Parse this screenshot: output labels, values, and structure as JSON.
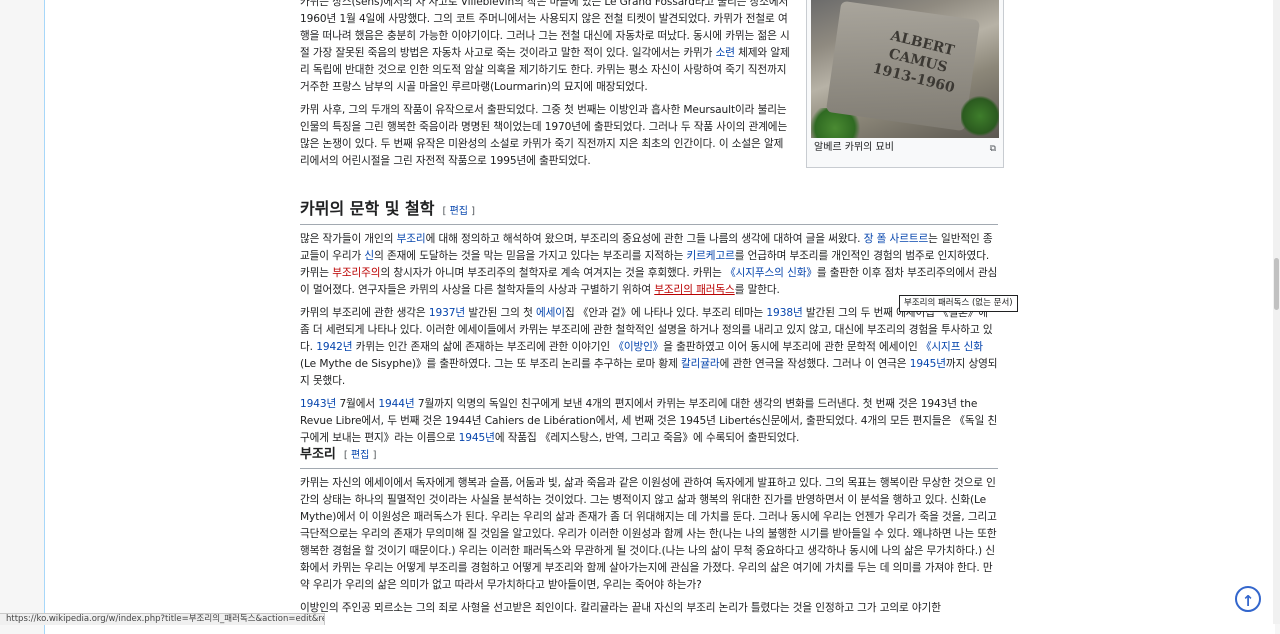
{
  "paragraphs": {
    "p1": "카뮈는 상스(sens)에서의 차 사고로 Villeblevin의 작은 마을에 있는 Le Grand Fossard라고 불리는 장소에서 1960년 1월 4일에 사망했다. 그의 코트 주머니에서는 사용되지 않은 전철 티켓이 발견되었다. 카뮈가 전철로 여행을 떠나려 했음은 충분히 가능한 이야기이다. 그러나 그는 전철 대신에 자동차로 떠났다. 동시에 카뮈는 젊은 시절 가장 잘못된 죽음의 방법은 자동차 사고로 죽는 것이라고 말한 적이 있다. 일각에서는 카뮈가 ",
    "p1_link": "소련",
    "p1_end": " 체제와 알제리 독립에 반대한 것으로 인한 의도적 암살 의혹을 제기하기도 한다. 카뮈는 평소 자신이 사랑하여 죽기 직전까지 거주한 프랑스 남부의 시골 마을인 루르마랭(Lourmarin)의 묘지에 매장되었다.",
    "p2": "카뮈 사후, 그의 두개의 작품이 유작으로서 출판되었다. 그중 첫 번째는 이방인과 흡사한 Meursault이라 불리는 인물의 특징을 그린 행복한 죽음이라 명명된 책이었는데 1970년에 출판되었다. 그러나 두 작품 사이의 관계에는 많은 논쟁이 있다. 두 번째 유작은 미완성의 소설로 카뮈가 죽기 직전까지 지은 최초의 인간이다. 이 소설은 알제리에서의 어린시절을 그린 자전적 작품으로 1995년에 출판되었다."
  },
  "thumb": {
    "engraving_line1": "ALBERT CAMUS",
    "engraving_line2": "1913-1960",
    "caption": "알베르 카뮈의 묘비",
    "magnify_icon": "⧉"
  },
  "section1": {
    "title": "카뮈의 문학 및 철학",
    "edit_open": "[ ",
    "edit_label": "편집",
    "edit_close": " ]",
    "p1": {
      "a": "많은 작가들이 개인의 ",
      "l1": "부조리",
      "b": "에 대해 정의하고 해석하여 왔으며, 부조리의 중요성에 관한 그들 나름의 생각에 대하여 글을 써왔다. ",
      "l2": "장 폴 사르트르",
      "c": "는 일반적인 종교들이 우리가 ",
      "l3": "신",
      "d": "의 존재에 도달하는 것을 막는 믿음을 가지고 있다는 부조리를 지적하는 ",
      "l4": "키르케고르",
      "e": "를 언급하며 부조리를 개인적인 경험의 범주로 인지하였다. 카뮈는 ",
      "l5": "부조리주의",
      "f": "의 창시자가 아니며 부조리주의 철학자로 계속 여겨지는 것을 후회했다. 카뮈는 ",
      "l6": "《시지푸스의 신화》",
      "g": "를 출판한 이후 점차 부조리주의에서 관심이 멀어졌다. 연구자들은 카뮈의 사상을 다른 철학자들의 사상과 구별하기 위하여 ",
      "l7": "부조리의 패러독스",
      "h": "를 말한다."
    },
    "p2": {
      "a": "카뮈의 부조리에 관한 생각은 ",
      "l1": "1937년",
      "b": " 발간된 그의 첫 ",
      "l2": "에세이",
      "c": "집 《안과 겉》에 나타나 있다. 부조리 테마는 ",
      "l3": "1938년",
      "d": " 발간된 그의 두 번째 에세이집 《결혼》에 좀 더 세련되게 나타나 있다. 이러한 에세이들에서 카뮈는 부조리에 관한 철학적인 설명을 하거나 정의를 내리고 있지 않고, 대신에 부조리의 경험을 투사하고 있다. ",
      "l4": "1942년",
      "e": " 카뮈는 인간 존재의 삶에 존재하는 부조리에 관한 이야기인 ",
      "l5": "《이방인》",
      "f": "을 출판하였고 이어 동시에 부조리에 관한 문학적 에세이인 ",
      "l6": "《시지프 신화",
      "g": "(Le Mythe de Sisyphe)》를 출판하였다. 그는 또 부조리 논리를 추구하는 로마 황제 ",
      "l7": "칼리귤라",
      "h": "에 관한 연극을 작성했다. 그러나 이 연극은 ",
      "l8": "1945년",
      "i": "까지 상영되지 못했다."
    },
    "p3": {
      "l1": "1943년",
      "a": " 7월에서 ",
      "l2": "1944년",
      "b": " 7월까지 익명의 독일인 친구에게 보낸 4개의 편지에서 카뮈는 부조리에 대한 생각의 변화를 드러낸다. 첫 번째 것은 1943년 the Revue Libre에서, 두 번째 것은 1944년 Cahiers de Libération에서, 세 번째 것은 1945년 Libertés신문에서, 출판되었다. 4개의 모든 편지들은 《독일 친구에게 보내는 편지》라는 이름으로 ",
      "l3": "1945년",
      "c": "에 작품집 《레지스탕스, 반역, 그리고 죽음》에 수록되어 출판되었다."
    }
  },
  "section2": {
    "title": "부조리",
    "edit_open": "[ ",
    "edit_label": "편집",
    "edit_close": " ]",
    "p1": "카뮈는 자신의 에세이에서 독자에게 행복과 슬픔, 어둠과 빛, 삶과 죽음과 같은 이원성에 관하여 독자에게 발표하고 있다. 그의 목표는 행복이란 무상한 것으로 인간의 상태는 하나의 필멸적인 것이라는 사실을 분석하는 것이었다. 그는 병적이지 않고 삶과 행복의 위대한 진가를 반영하면서 이 분석을 행하고 있다. 신화(Le Mythe)에서 이 이원성은 패러독스가 된다. 우리는 우리의 삶과 존재가 좀 더 위대해지는 데 가치를 둔다. 그러나 동시에 우리는 언젠가 우리가 죽을 것을, 그리고 극단적으로는 우리의 존재가 무의미해 질 것임을 알고있다. 우리가 이러한 이원성과 함께 사는 한(나는 나의 불행한 시기를 받아들일 수 있다. 왜냐하면 나는 또한 행복한 경험을 할 것이기 때문이다.) 우리는 이러한 패러독스와 무관하게 될 것이다.(나는 나의 삶이 무척 중요하다고 생각하나 동시에 나의 삶은 무가치하다.) 신화에서 카뮈는 우리는 어떻게 부조리를 경험하고 어떻게 부조리와 함께 살아가는지에 관심을 가졌다. 우리의 삶은 여기에 가치를 두는 데 의미를 가져야 한다. 만약 우리가 우리의 삶은 의미가 없고 따라서 무가치하다고 받아들이면, 우리는 죽어야 하는가?",
    "p2": "이방인의 주인공 뫼르소는 그의 죄로 사형을 선고받은 죄인이다. 칼리귤라는 끝내 자신의 부조리 논리가 틀렸다는 것을 인정하고 그가 고의로 야기한"
  },
  "tooltip": "부조리의 패러독스 (없는 문서)",
  "statusbar": "https://ko.wikipedia.org/w/index.php?title=부조리의_패러독스&action=edit&redlink=1",
  "totop_icon": "↑",
  "colors": {
    "link": "#0645ad",
    "redlink": "#ba0000",
    "accent": "#3366cc"
  }
}
